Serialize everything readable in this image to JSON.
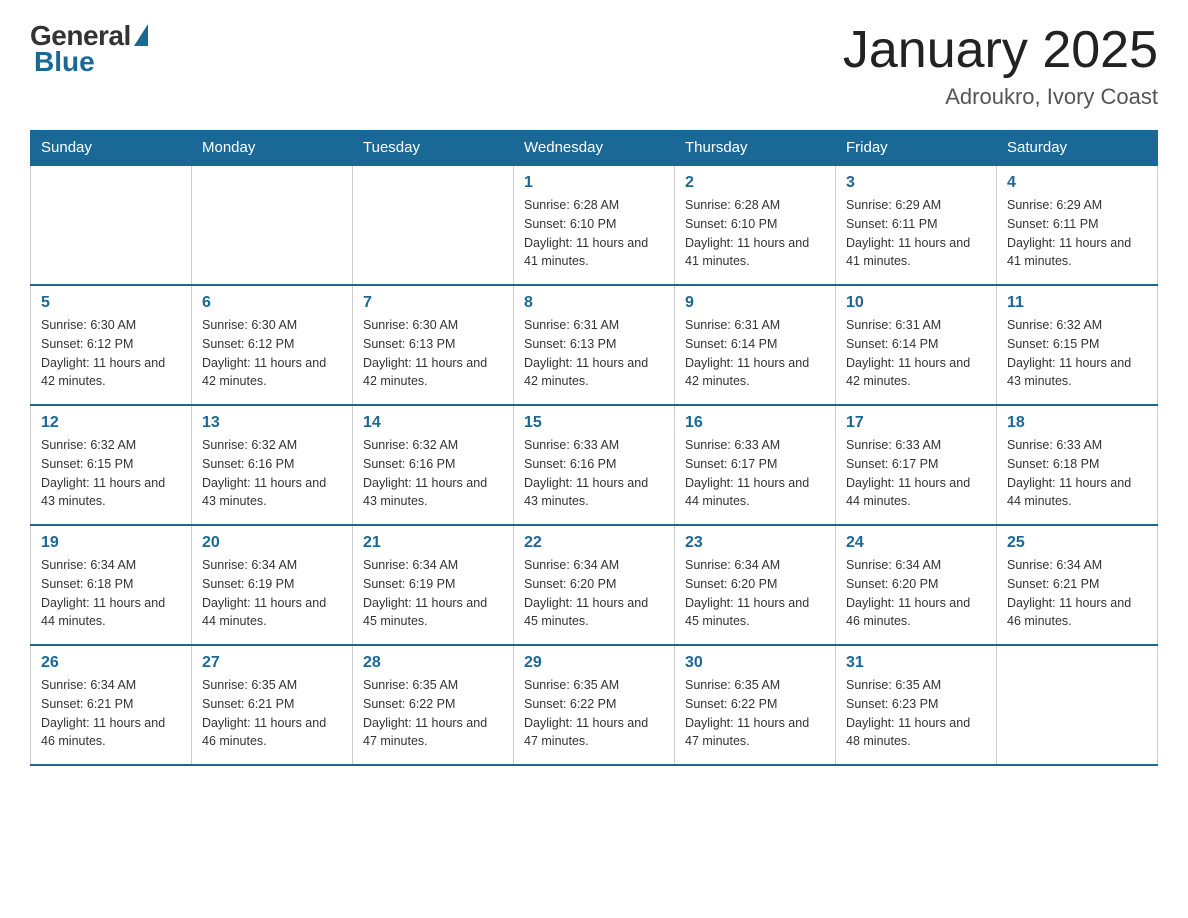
{
  "logo": {
    "general": "General",
    "blue": "Blue"
  },
  "header": {
    "month": "January 2025",
    "location": "Adroukro, Ivory Coast"
  },
  "days_of_week": [
    "Sunday",
    "Monday",
    "Tuesday",
    "Wednesday",
    "Thursday",
    "Friday",
    "Saturday"
  ],
  "weeks": [
    [
      {
        "day": "",
        "info": ""
      },
      {
        "day": "",
        "info": ""
      },
      {
        "day": "",
        "info": ""
      },
      {
        "day": "1",
        "info": "Sunrise: 6:28 AM\nSunset: 6:10 PM\nDaylight: 11 hours and 41 minutes."
      },
      {
        "day": "2",
        "info": "Sunrise: 6:28 AM\nSunset: 6:10 PM\nDaylight: 11 hours and 41 minutes."
      },
      {
        "day": "3",
        "info": "Sunrise: 6:29 AM\nSunset: 6:11 PM\nDaylight: 11 hours and 41 minutes."
      },
      {
        "day": "4",
        "info": "Sunrise: 6:29 AM\nSunset: 6:11 PM\nDaylight: 11 hours and 41 minutes."
      }
    ],
    [
      {
        "day": "5",
        "info": "Sunrise: 6:30 AM\nSunset: 6:12 PM\nDaylight: 11 hours and 42 minutes."
      },
      {
        "day": "6",
        "info": "Sunrise: 6:30 AM\nSunset: 6:12 PM\nDaylight: 11 hours and 42 minutes."
      },
      {
        "day": "7",
        "info": "Sunrise: 6:30 AM\nSunset: 6:13 PM\nDaylight: 11 hours and 42 minutes."
      },
      {
        "day": "8",
        "info": "Sunrise: 6:31 AM\nSunset: 6:13 PM\nDaylight: 11 hours and 42 minutes."
      },
      {
        "day": "9",
        "info": "Sunrise: 6:31 AM\nSunset: 6:14 PM\nDaylight: 11 hours and 42 minutes."
      },
      {
        "day": "10",
        "info": "Sunrise: 6:31 AM\nSunset: 6:14 PM\nDaylight: 11 hours and 42 minutes."
      },
      {
        "day": "11",
        "info": "Sunrise: 6:32 AM\nSunset: 6:15 PM\nDaylight: 11 hours and 43 minutes."
      }
    ],
    [
      {
        "day": "12",
        "info": "Sunrise: 6:32 AM\nSunset: 6:15 PM\nDaylight: 11 hours and 43 minutes."
      },
      {
        "day": "13",
        "info": "Sunrise: 6:32 AM\nSunset: 6:16 PM\nDaylight: 11 hours and 43 minutes."
      },
      {
        "day": "14",
        "info": "Sunrise: 6:32 AM\nSunset: 6:16 PM\nDaylight: 11 hours and 43 minutes."
      },
      {
        "day": "15",
        "info": "Sunrise: 6:33 AM\nSunset: 6:16 PM\nDaylight: 11 hours and 43 minutes."
      },
      {
        "day": "16",
        "info": "Sunrise: 6:33 AM\nSunset: 6:17 PM\nDaylight: 11 hours and 44 minutes."
      },
      {
        "day": "17",
        "info": "Sunrise: 6:33 AM\nSunset: 6:17 PM\nDaylight: 11 hours and 44 minutes."
      },
      {
        "day": "18",
        "info": "Sunrise: 6:33 AM\nSunset: 6:18 PM\nDaylight: 11 hours and 44 minutes."
      }
    ],
    [
      {
        "day": "19",
        "info": "Sunrise: 6:34 AM\nSunset: 6:18 PM\nDaylight: 11 hours and 44 minutes."
      },
      {
        "day": "20",
        "info": "Sunrise: 6:34 AM\nSunset: 6:19 PM\nDaylight: 11 hours and 44 minutes."
      },
      {
        "day": "21",
        "info": "Sunrise: 6:34 AM\nSunset: 6:19 PM\nDaylight: 11 hours and 45 minutes."
      },
      {
        "day": "22",
        "info": "Sunrise: 6:34 AM\nSunset: 6:20 PM\nDaylight: 11 hours and 45 minutes."
      },
      {
        "day": "23",
        "info": "Sunrise: 6:34 AM\nSunset: 6:20 PM\nDaylight: 11 hours and 45 minutes."
      },
      {
        "day": "24",
        "info": "Sunrise: 6:34 AM\nSunset: 6:20 PM\nDaylight: 11 hours and 46 minutes."
      },
      {
        "day": "25",
        "info": "Sunrise: 6:34 AM\nSunset: 6:21 PM\nDaylight: 11 hours and 46 minutes."
      }
    ],
    [
      {
        "day": "26",
        "info": "Sunrise: 6:34 AM\nSunset: 6:21 PM\nDaylight: 11 hours and 46 minutes."
      },
      {
        "day": "27",
        "info": "Sunrise: 6:35 AM\nSunset: 6:21 PM\nDaylight: 11 hours and 46 minutes."
      },
      {
        "day": "28",
        "info": "Sunrise: 6:35 AM\nSunset: 6:22 PM\nDaylight: 11 hours and 47 minutes."
      },
      {
        "day": "29",
        "info": "Sunrise: 6:35 AM\nSunset: 6:22 PM\nDaylight: 11 hours and 47 minutes."
      },
      {
        "day": "30",
        "info": "Sunrise: 6:35 AM\nSunset: 6:22 PM\nDaylight: 11 hours and 47 minutes."
      },
      {
        "day": "31",
        "info": "Sunrise: 6:35 AM\nSunset: 6:23 PM\nDaylight: 11 hours and 48 minutes."
      },
      {
        "day": "",
        "info": ""
      }
    ]
  ]
}
